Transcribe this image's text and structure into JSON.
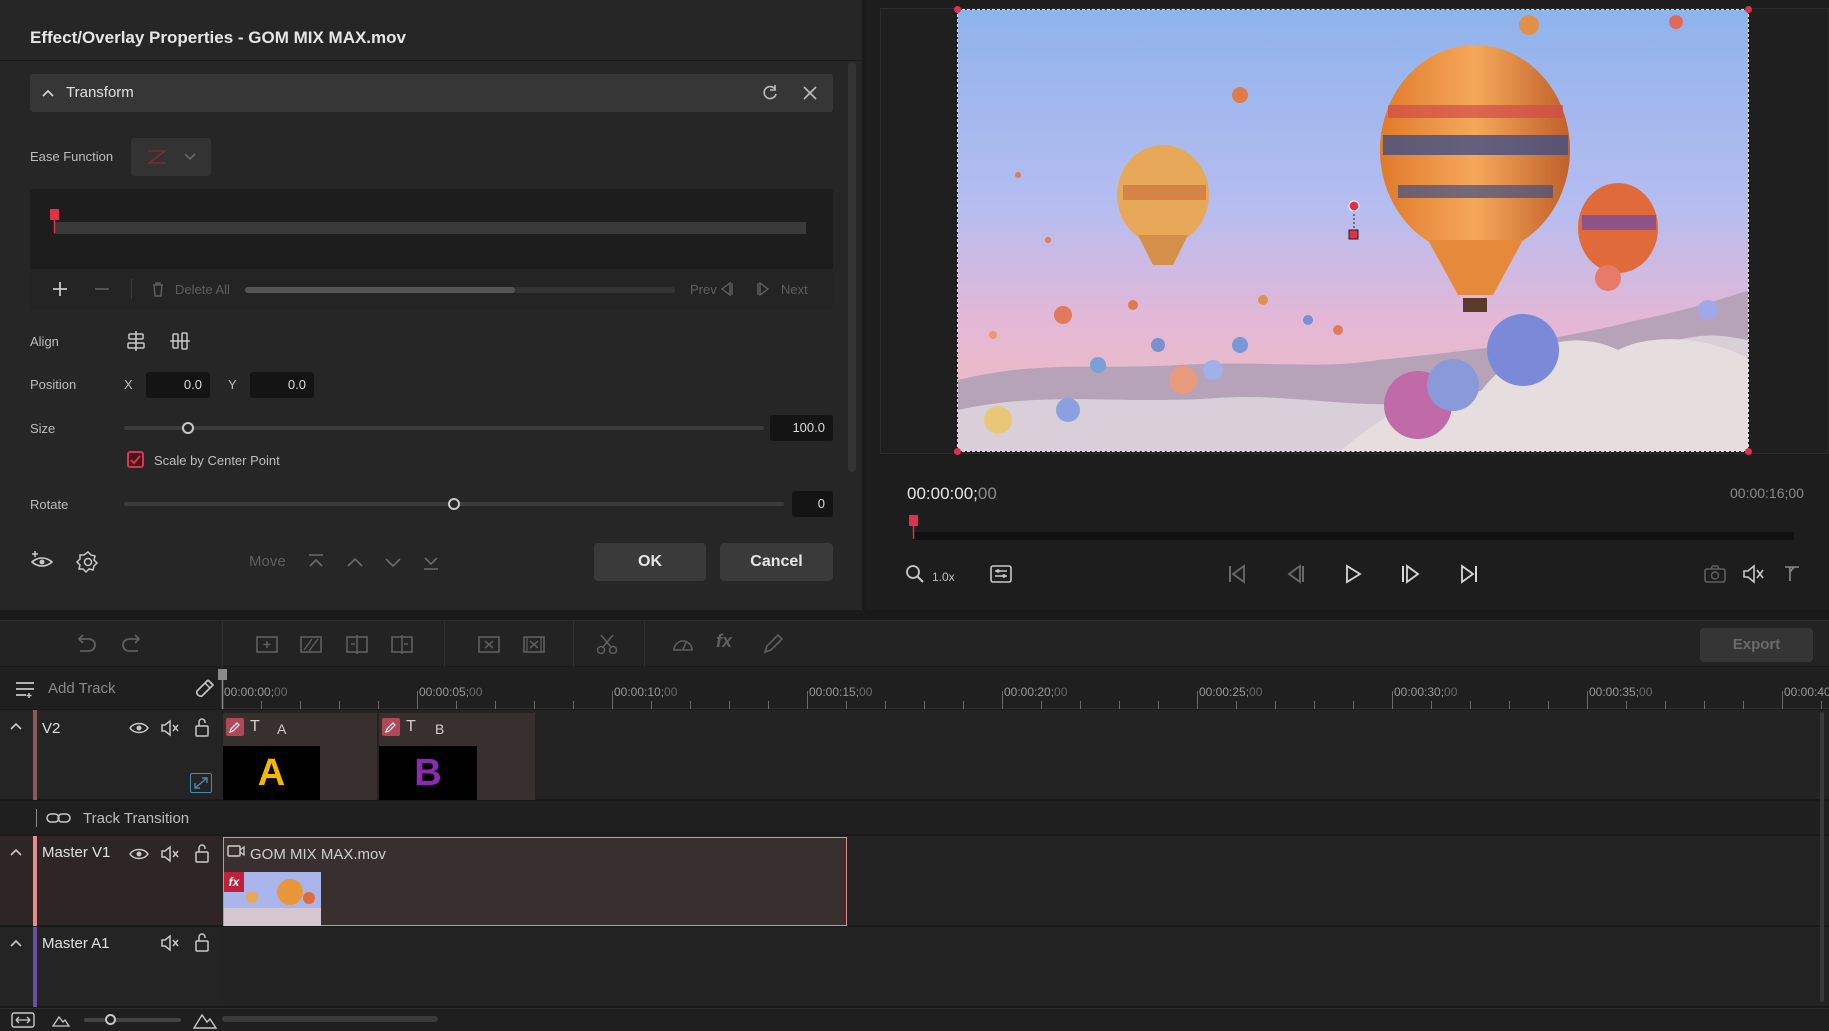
{
  "props": {
    "title": "Effect/Overlay Properties - GOM MIX MAX.mov",
    "section_title": "Transform",
    "ease_label": "Ease Function",
    "delete_all": "Delete All",
    "prev": "Prev",
    "next": "Next",
    "align_label": "Align",
    "position_label": "Position",
    "x_label": "X",
    "x_value": "0.0",
    "y_label": "Y",
    "y_value": "0.0",
    "size_label": "Size",
    "size_value": "100.0",
    "size_level": 0.1,
    "scale_center_label": "Scale by Center Point",
    "scale_center_checked": true,
    "rotate_label": "Rotate",
    "rotate_value": "0",
    "rotate_level": 0.5,
    "move_label": "Move",
    "ok": "OK",
    "cancel": "Cancel"
  },
  "preview": {
    "current_time": "00:00:00;",
    "current_frames": "00",
    "total_time": "00:00:16;00",
    "zoom": "1.0x"
  },
  "toolbar": {
    "export": "Export"
  },
  "timeline": {
    "add_track": "Add Track",
    "ruler_labels": [
      {
        "t": "00:00:00;",
        "f": "00"
      },
      {
        "t": "00:00:05;",
        "f": "00"
      },
      {
        "t": "00:00:10;",
        "f": "00"
      },
      {
        "t": "00:00:15;",
        "f": "00"
      },
      {
        "t": "00:00:20;",
        "f": "00"
      },
      {
        "t": "00:00:25;",
        "f": "00"
      },
      {
        "t": "00:00:30;",
        "f": "00"
      },
      {
        "t": "00:00:35;",
        "f": "00"
      },
      {
        "t": "00:00:40",
        "f": ""
      }
    ],
    "tracks": {
      "v2": "V2",
      "transition": "Track Transition",
      "master_v1": "Master V1",
      "master_a1": "Master A1"
    },
    "clips": {
      "text_a": "A",
      "text_b": "B",
      "video": "GOM MIX MAX.mov"
    }
  },
  "colors": {
    "accent": "#e0304c",
    "clip_a_letter": "#f5b800",
    "clip_b_letter": "#8a2bb0",
    "master_v1_strip": "#e88a8a",
    "master_a1_strip": "#6a4fa8",
    "v2_strip": "#8a5a5a"
  }
}
